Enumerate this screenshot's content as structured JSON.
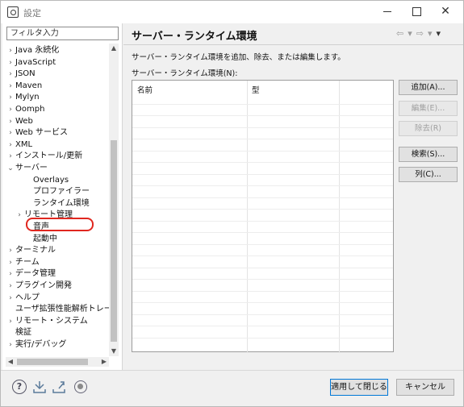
{
  "window": {
    "title": "設定",
    "minimize_glyph": "",
    "maximize_glyph": "",
    "close_glyph": "✕"
  },
  "sidebar": {
    "filter_placeholder": "フィルタ入力",
    "tree": [
      {
        "label": "Java 永続化",
        "arrow": "›",
        "indent": 0
      },
      {
        "label": "JavaScript",
        "arrow": "›",
        "indent": 0
      },
      {
        "label": "JSON",
        "arrow": "›",
        "indent": 0
      },
      {
        "label": "Maven",
        "arrow": "›",
        "indent": 0
      },
      {
        "label": "Mylyn",
        "arrow": "›",
        "indent": 0
      },
      {
        "label": "Oomph",
        "arrow": "›",
        "indent": 0
      },
      {
        "label": "Web",
        "arrow": "›",
        "indent": 0
      },
      {
        "label": "Web サービス",
        "arrow": "›",
        "indent": 0
      },
      {
        "label": "XML",
        "arrow": "›",
        "indent": 0
      },
      {
        "label": "インストール/更新",
        "arrow": "›",
        "indent": 0
      },
      {
        "label": "サーバー",
        "arrow": "⌄",
        "indent": 0
      },
      {
        "label": "Overlays",
        "arrow": "",
        "indent": 2
      },
      {
        "label": "プロファイラー",
        "arrow": "",
        "indent": 2
      },
      {
        "label": "ランタイム環境",
        "arrow": "",
        "indent": 2
      },
      {
        "label": "リモート管理",
        "arrow": "›",
        "indent": 1
      },
      {
        "label": "音声",
        "arrow": "",
        "indent": 2
      },
      {
        "label": "起動中",
        "arrow": "",
        "indent": 2
      },
      {
        "label": "ターミナル",
        "arrow": "›",
        "indent": 0
      },
      {
        "label": "チーム",
        "arrow": "›",
        "indent": 0
      },
      {
        "label": "データ管理",
        "arrow": "›",
        "indent": 0
      },
      {
        "label": "プラグイン開発",
        "arrow": "›",
        "indent": 0
      },
      {
        "label": "ヘルプ",
        "arrow": "›",
        "indent": 0
      },
      {
        "label": "ユーザ拡張性能解析トレース",
        "arrow": "",
        "indent": 0
      },
      {
        "label": "リモート・システム",
        "arrow": "›",
        "indent": 0
      },
      {
        "label": "検証",
        "arrow": "",
        "indent": 0
      },
      {
        "label": "実行/デバッグ",
        "arrow": "›",
        "indent": 0
      }
    ],
    "selected_label": "ランタイム環境"
  },
  "main": {
    "title": "サーバー・ランタイム環境",
    "description": "サーバー・ランタイム環境を追加、除去、または編集します。",
    "table_label": "サーバー・ランタイム環境(N):",
    "columns": [
      "名前",
      "型"
    ],
    "rows": [],
    "buttons": [
      {
        "label": "追加(A)...",
        "enabled": true
      },
      {
        "label": "編集(E)...",
        "enabled": false
      },
      {
        "label": "除去(R)",
        "enabled": false
      },
      {
        "label": "検索(S)...",
        "enabled": true
      },
      {
        "label": "列(C)...",
        "enabled": true
      }
    ]
  },
  "footer": {
    "help_glyph": "?",
    "apply_close": "適用して閉じる",
    "cancel": "キャンセル"
  }
}
